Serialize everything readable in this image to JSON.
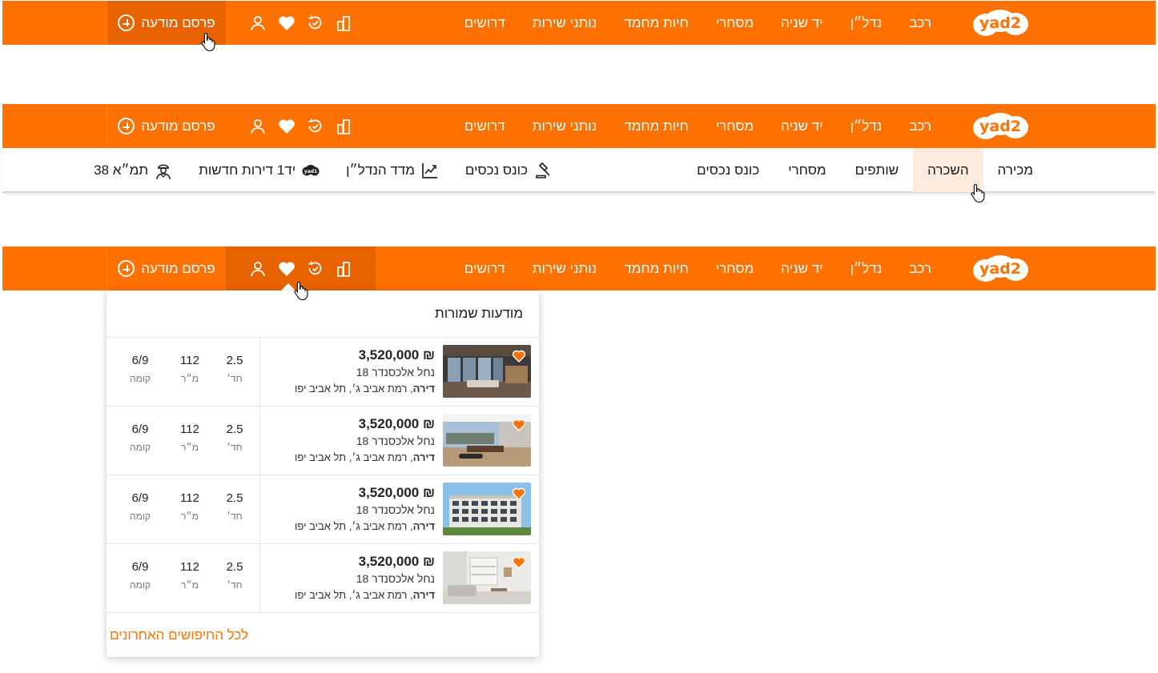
{
  "logo": {
    "text": "yad2"
  },
  "nav": [
    {
      "label": "רכב"
    },
    {
      "label": "נדל״ן"
    },
    {
      "label": "יד שניה"
    },
    {
      "label": "מסחרי"
    },
    {
      "label": "חיות מחמד"
    },
    {
      "label": "נותני שירות"
    },
    {
      "label": "דרושים"
    }
  ],
  "header_icons": [
    "compare-icon",
    "recent-searches-icon",
    "favorites-heart-icon",
    "user-icon"
  ],
  "publish_label": "פרסם מודעה",
  "subnav": {
    "tabs": [
      {
        "label": "מכירה"
      },
      {
        "label": "השכרה"
      },
      {
        "label": "שותפים"
      },
      {
        "label": "מסחרי"
      },
      {
        "label": "כונס נכסים"
      }
    ],
    "links": [
      {
        "label": "כונס נכסים",
        "icon": "gavel-icon"
      },
      {
        "label": "מדד הנדל״ן",
        "icon": "trend-chart-icon"
      },
      {
        "label": "יד1 דירות חדשות",
        "icon": "yad1-logo-icon"
      },
      {
        "label": "תמ״א 38",
        "icon": "worker-icon"
      }
    ]
  },
  "saved": {
    "title": "מודעות שמורות",
    "items": [
      {
        "price": "₪ 3,520,000",
        "street": "נחל אלכסנדר 18",
        "type": "דירה",
        "area": ", רמת אביב ג׳, תל אביב יפו",
        "rooms": "2.5",
        "rooms_unit": "חד׳",
        "size": "112",
        "size_unit": "מ״ר",
        "floor": "6/9",
        "floor_unit": "קומה",
        "image": "living-room-night"
      },
      {
        "price": "₪ 3,520,000",
        "street": "נחל אלכסנדר 18",
        "type": "דירה",
        "area": ", רמת אביב ג׳, תל אביב יפו",
        "rooms": "2.5",
        "rooms_unit": "חד׳",
        "size": "112",
        "size_unit": "מ״ר",
        "floor": "6/9",
        "floor_unit": "קומה",
        "image": "penthouse-view"
      },
      {
        "price": "₪ 3,520,000",
        "street": "נחל אלכסנדר 18",
        "type": "דירה",
        "area": ", רמת אביב ג׳, תל אביב יפו",
        "rooms": "2.5",
        "rooms_unit": "חד׳",
        "size": "112",
        "size_unit": "מ״ר",
        "floor": "6/9",
        "floor_unit": "קומה",
        "image": "building-exterior"
      },
      {
        "price": "₪ 3,520,000",
        "street": "נחל אלכסנדר 18",
        "type": "דירה",
        "area": ", רמת אביב ג׳, תל אביב יפו",
        "rooms": "2.5",
        "rooms_unit": "חד׳",
        "size": "112",
        "size_unit": "מ״ר",
        "floor": "6/9",
        "floor_unit": "קומה",
        "image": "white-living-room"
      }
    ],
    "footer_link": "לכל החיפושים האחרונים"
  },
  "colors": {
    "brand": "#ff7100",
    "brand_dark": "#e86300",
    "tab_active_bg": "#fdebdd"
  }
}
